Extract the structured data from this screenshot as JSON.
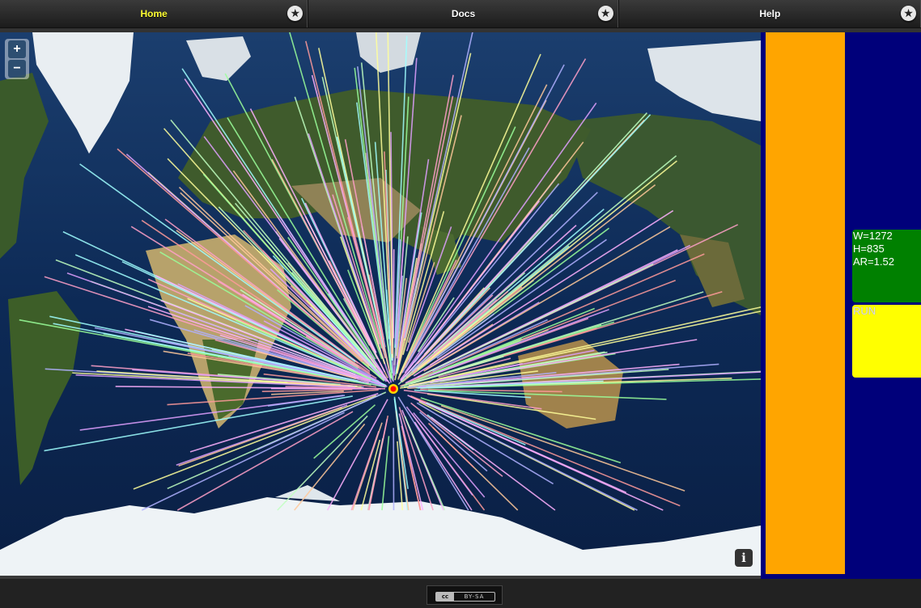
{
  "nav": {
    "tabs": [
      {
        "label": "Home",
        "active": true,
        "star_icon": "star-icon"
      },
      {
        "label": "Docs",
        "active": false,
        "star_icon": "star-icon"
      },
      {
        "label": "Help",
        "active": false,
        "star_icon": "star-icon"
      }
    ]
  },
  "map": {
    "zoom_in": "+",
    "zoom_out": "−",
    "info": "i",
    "center_marker_color": "#ff0000",
    "line_palette": [
      "#ff9a9a",
      "#9aff9a",
      "#b0b0ff",
      "#ffff9a",
      "#ffb0ff",
      "#a0ffff",
      "#ffc89a",
      "#e0a0ff",
      "#c0ffc0",
      "#ffa0c8"
    ]
  },
  "side": {
    "stats": {
      "w": "W=1272",
      "h": "H=835",
      "ar": "AR=1.52"
    },
    "run_label": "RUN",
    "colors": {
      "panel": "#00007a",
      "orange": "#ffa500",
      "green": "#008000",
      "yellow": "#ffff00"
    }
  },
  "footer": {
    "cc_icon": "cc",
    "license": "BY-SA"
  }
}
